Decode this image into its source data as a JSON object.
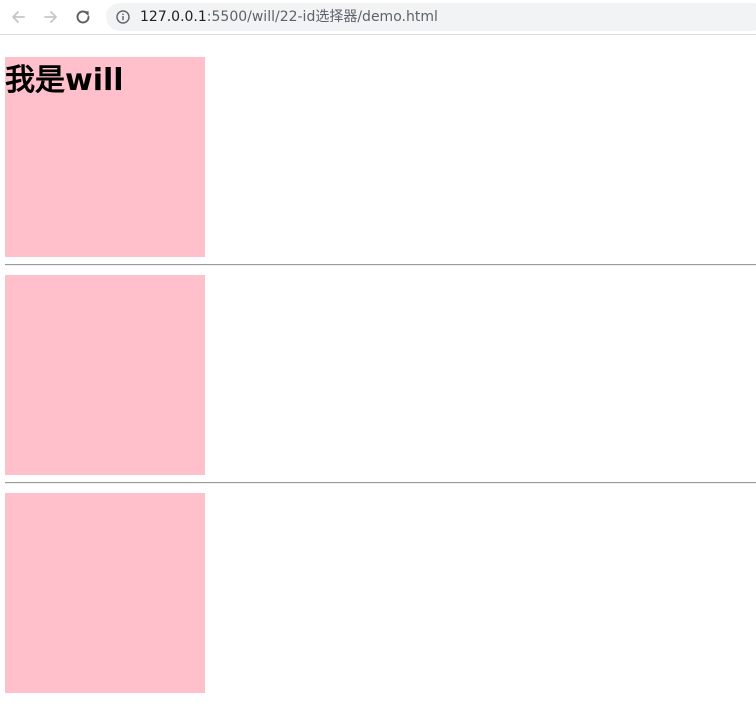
{
  "browser": {
    "url_host": "127.0.0.1",
    "url_path": ":5500/will/22-id选择器/demo.html",
    "icons": {
      "back": "back-arrow-icon",
      "forward": "forward-arrow-icon",
      "reload": "reload-icon",
      "site_info": "info-icon"
    }
  },
  "content": {
    "box1_heading": "我是will",
    "box_color": "#ffc0cb"
  }
}
